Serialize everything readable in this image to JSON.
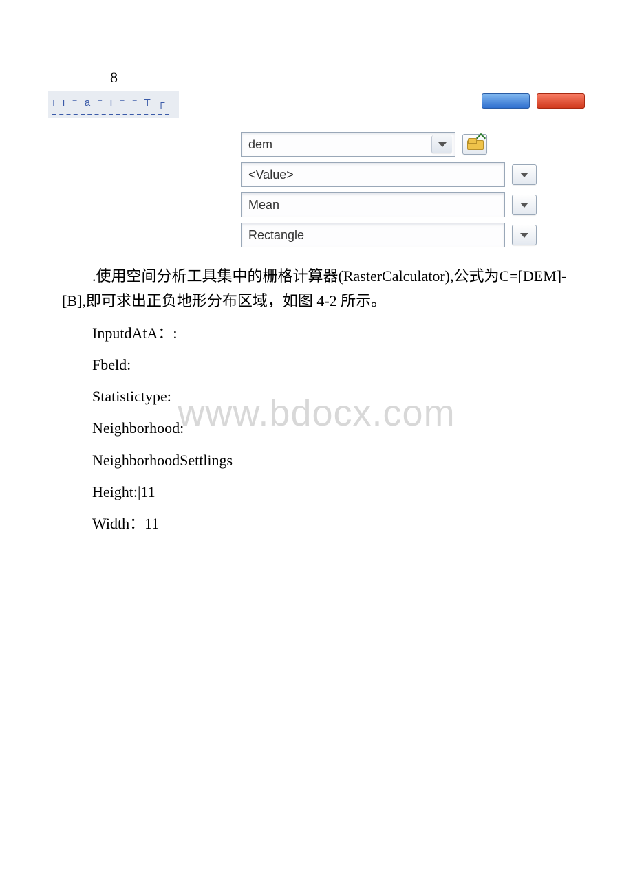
{
  "page_number": "8",
  "left_fragment_text": "ı ı ⁻ a ⁻ ı ⁻ ⁻ T ┌ ⁻",
  "form": {
    "input_data_value": "dem",
    "field_value": "<Value>",
    "stat_type_value": "Mean",
    "neighborhood_value": "Rectangle"
  },
  "paragraph_main": ".使用空间分析工具集中的栅格计算器(RasterCalculator),公式为C=[DEM]-[B],即可求出正负地形分布区域，如图 4-2 所示。",
  "labels": {
    "input_data": "InputdAtA：:",
    "field": "Fbeld:",
    "stat_type": "Statistictype:",
    "neighborhood": "Neighborhood:",
    "neighborhood_settings": "NeighborhoodSettlings",
    "height": "Height:|11",
    "width": "Width：11"
  },
  "watermark": "www.bdocx.com"
}
